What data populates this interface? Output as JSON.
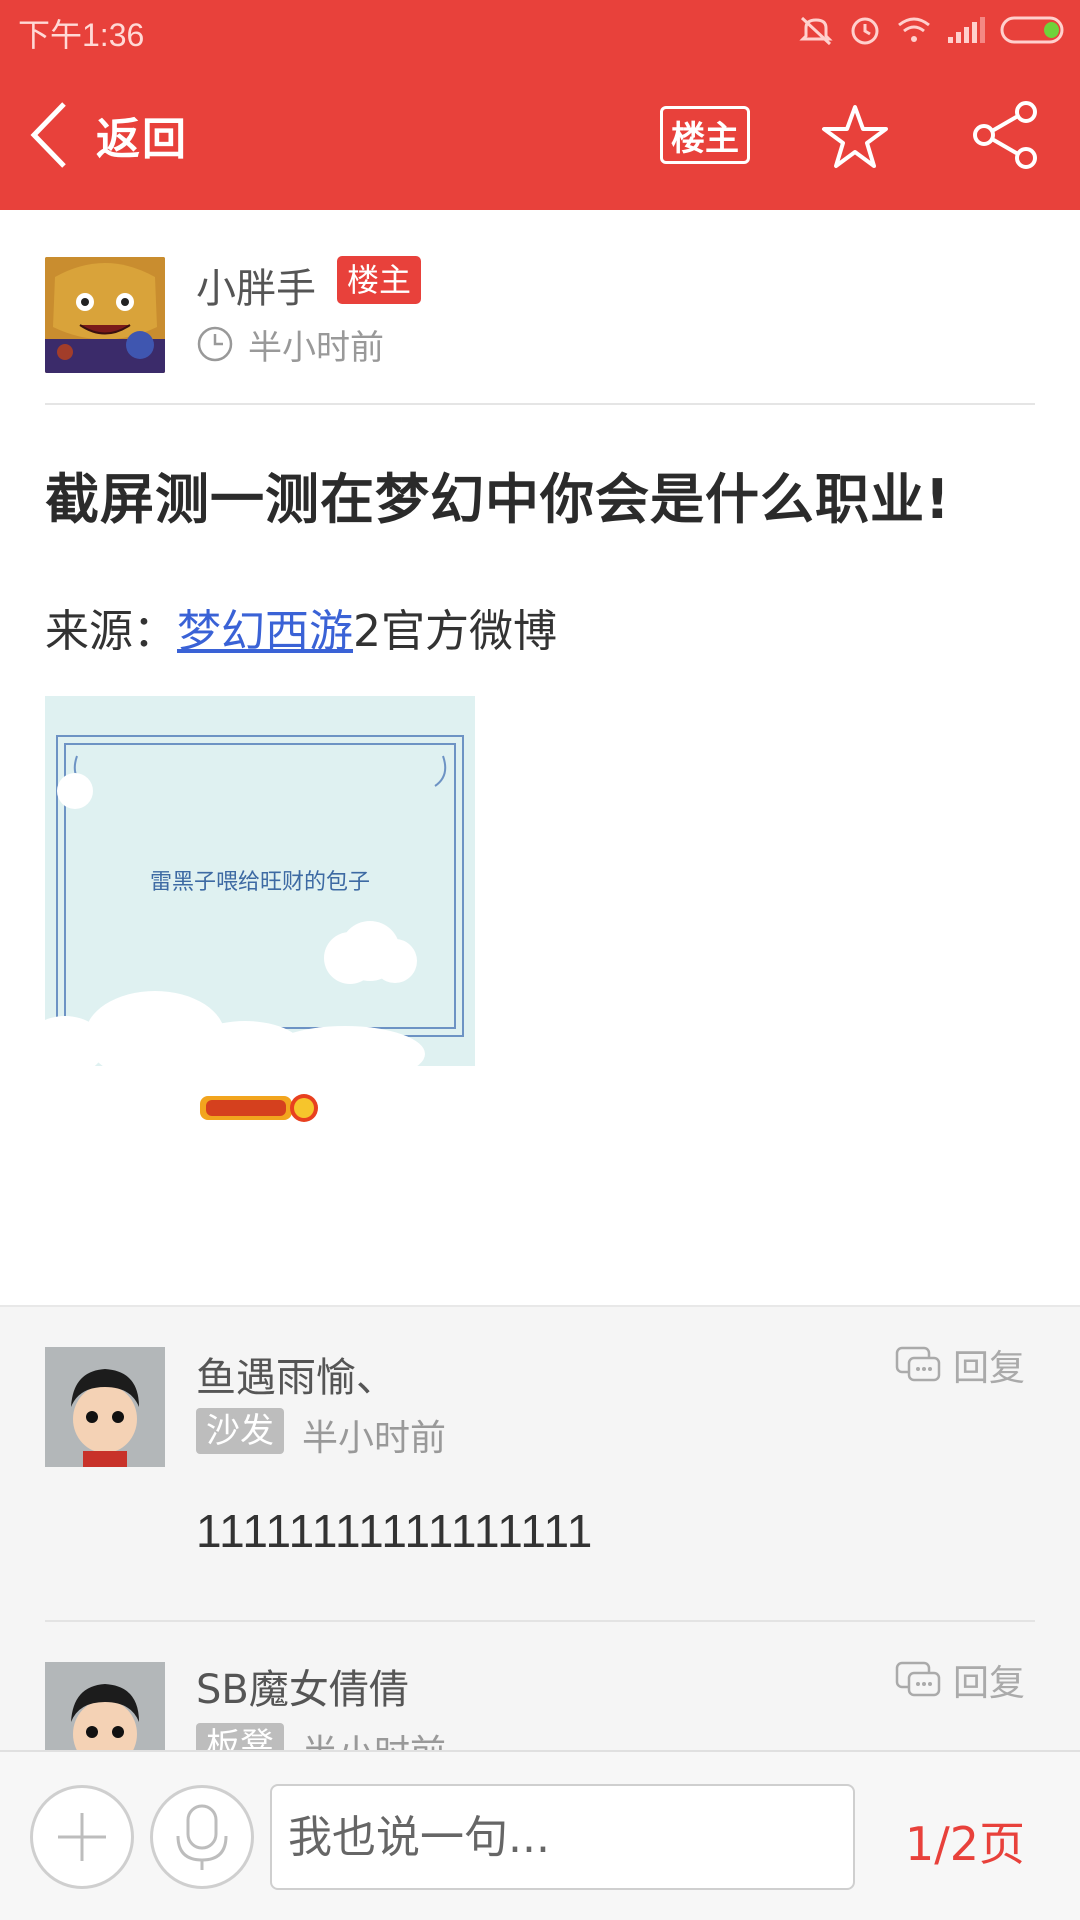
{
  "status_bar": {
    "time": "下午1:36"
  },
  "header": {
    "back_label": "返回",
    "op_filter_label": "楼主"
  },
  "post": {
    "author": "小胖手",
    "author_badge": "楼主",
    "time": "半小时前",
    "title": "截屏测一测在梦幻中你会是什么职业!",
    "source_prefix": "来源：",
    "source_link": "梦幻西游",
    "source_suffix": "2官方微博",
    "image_caption": "雷黑子喂给旺财的包子"
  },
  "comments": [
    {
      "author": "鱼遇雨愉、",
      "badge": "沙发",
      "time": "半小时前",
      "reply_label": "回复",
      "text": "11111111111111111"
    },
    {
      "author": "SB魔女倩倩",
      "badge": "板凳",
      "time": "半小时前",
      "reply_label": "回复"
    }
  ],
  "bottom_bar": {
    "input_placeholder": "我也说一句...",
    "page_indicator": "1/2页"
  },
  "colors": {
    "accent": "#e8413b",
    "link": "#3a62d6"
  }
}
